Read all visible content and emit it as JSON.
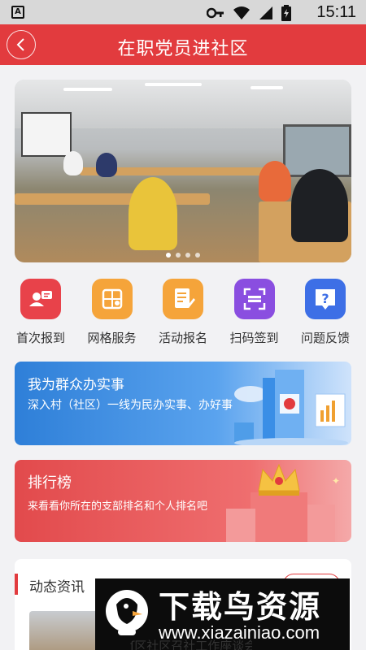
{
  "status_bar": {
    "app_icon": "A",
    "time": "15:11",
    "icons": [
      "key-icon",
      "wifi-icon",
      "signal-icon",
      "battery-charging-icon"
    ]
  },
  "header": {
    "title": "在职党员进社区",
    "back_icon": "chevron-left-icon"
  },
  "banner": {
    "slide_count": 4,
    "active_slide": 1
  },
  "quick_actions": [
    {
      "label": "首次报到",
      "icon": "user-card-icon",
      "color": "#e8424a"
    },
    {
      "label": "网格服务",
      "icon": "grid-service-icon",
      "color": "#f5a43a"
    },
    {
      "label": "活动报名",
      "icon": "form-edit-icon",
      "color": "#f5a43a"
    },
    {
      "label": "扫码签到",
      "icon": "scan-icon",
      "color": "#8a4ee0"
    },
    {
      "label": "问题反馈",
      "icon": "question-icon",
      "color": "#3d6fe6"
    }
  ],
  "service_card": {
    "title": "我为群众办实事",
    "subtitle": "深入村（社区）一线为民办实事、办好事",
    "color": "#2e7fd8"
  },
  "ranking_card": {
    "title": "排行榜",
    "subtitle": "来看看你所在的支部排名和个人排名吧",
    "color": "#e24a4c"
  },
  "news": {
    "title": "动态资讯",
    "accent": "#e23b3e",
    "partial_item_text": "ſ区社区召社工作座谈会"
  },
  "watermark": {
    "title": "下载鸟资源",
    "url": "www.xiazainiao.com"
  }
}
